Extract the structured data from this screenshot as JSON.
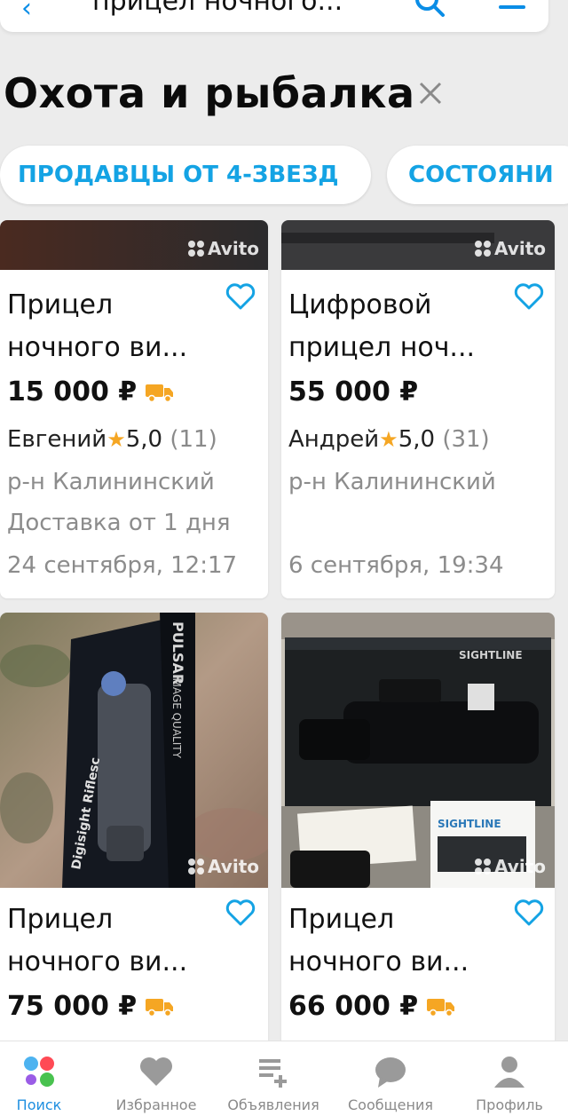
{
  "search": {
    "query": "прицел ночного..."
  },
  "category": {
    "title": "Охота и рыбалка"
  },
  "filters": [
    {
      "label": "ПРОДАВЦЫ ОТ 4-ЗВЕЗД"
    },
    {
      "label": "СОСТОЯНИ"
    }
  ],
  "watermark": "Avito",
  "listings": [
    {
      "title_line1": "Прицел",
      "title_line2": "ночного ви...",
      "price": "15 000 ₽",
      "delivery": true,
      "seller": "Евгений",
      "rating": "5,0",
      "reviews": "(11)",
      "district": "р-н Калининский",
      "shipping": "Доставка от 1 дня",
      "date": "24 сентября, 12:17"
    },
    {
      "title_line1": "Цифровой",
      "title_line2": "прицел ноч...",
      "price": "55 000 ₽",
      "delivery": false,
      "seller": "Андрей",
      "rating": "5,0",
      "reviews": "(31)",
      "district": "р-н Калининский",
      "date": "6 сентября, 19:34"
    },
    {
      "title_line1": "Прицел",
      "title_line2": "ночного ви...",
      "price": "75 000 ₽",
      "delivery": true,
      "box_brand": "PULSAR",
      "box_text": "IMAGE QUALITY",
      "box_model": "Digisight Riflesc"
    },
    {
      "title_line1": "Прицел",
      "title_line2": "ночного ви...",
      "price": "66 000 ₽",
      "delivery": true,
      "box_brand": "SIGHTLINE",
      "leaflet_brand": "SIGHTLINE"
    }
  ],
  "tabbar": [
    {
      "label": "Поиск",
      "icon": "search-tab-icon",
      "active": true
    },
    {
      "label": "Избранное",
      "icon": "heart-icon",
      "active": false
    },
    {
      "label": "Объявления",
      "icon": "listings-icon",
      "active": false
    },
    {
      "label": "Сообщения",
      "icon": "chat-icon",
      "active": false
    },
    {
      "label": "Профиль",
      "icon": "profile-icon",
      "active": false
    }
  ],
  "colors": {
    "accent": "#14a3e4",
    "star": "#f5a623",
    "truck": "#f5a623",
    "tab_active": "#1f8fe0"
  }
}
